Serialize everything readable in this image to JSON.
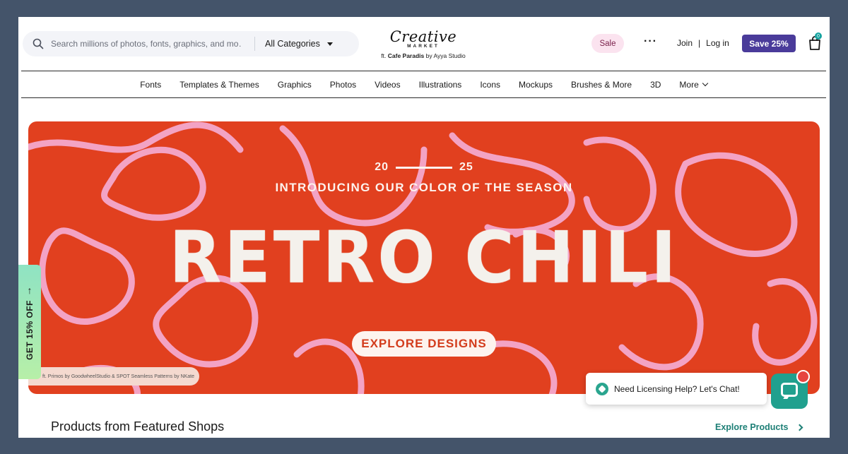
{
  "header": {
    "search_placeholder": "Search millions of photos, fonts, graphics, and mo…",
    "categories_label": "All Categories",
    "logo_line1": "Creative",
    "logo_line2": "MARKET",
    "logo_credit_prefix": "ft.",
    "logo_credit_name": "Cafe Paradis",
    "logo_credit_suffix": "by Ayya Studio",
    "sale_label": "Sale",
    "more_label": "···",
    "join_label": "Join",
    "separator": "|",
    "login_label": "Log in",
    "save_label": "Save 25%",
    "cart_count": "0"
  },
  "nav": {
    "items": [
      {
        "label": "Fonts"
      },
      {
        "label": "Templates & Themes"
      },
      {
        "label": "Graphics"
      },
      {
        "label": "Photos"
      },
      {
        "label": "Videos"
      },
      {
        "label": "Illustrations"
      },
      {
        "label": "Icons"
      },
      {
        "label": "Mockups"
      },
      {
        "label": "Brushes & More"
      },
      {
        "label": "3D"
      },
      {
        "label": "More"
      }
    ]
  },
  "hero": {
    "year_left": "20",
    "year_right": "25",
    "intro": "INTRODUCING OUR COLOR OF THE SEASON",
    "title": "RETRO CHILI",
    "cta_label": "EXPLORE DESIGNS",
    "credit": "ft. Primos by GoodwheelStudio & SPOT Seamless Patterns by NKate",
    "colors": {
      "background": "#e1401f",
      "pattern": "#f3a3c4",
      "text": "#f4f1ec"
    }
  },
  "side_tab": {
    "label": "GET 15% OFF",
    "arrow": "↑"
  },
  "chat": {
    "prompt": "Need Licensing Help? Let's Chat!"
  },
  "section": {
    "title": "Products from Featured Shops",
    "link_label": "Explore Products"
  }
}
